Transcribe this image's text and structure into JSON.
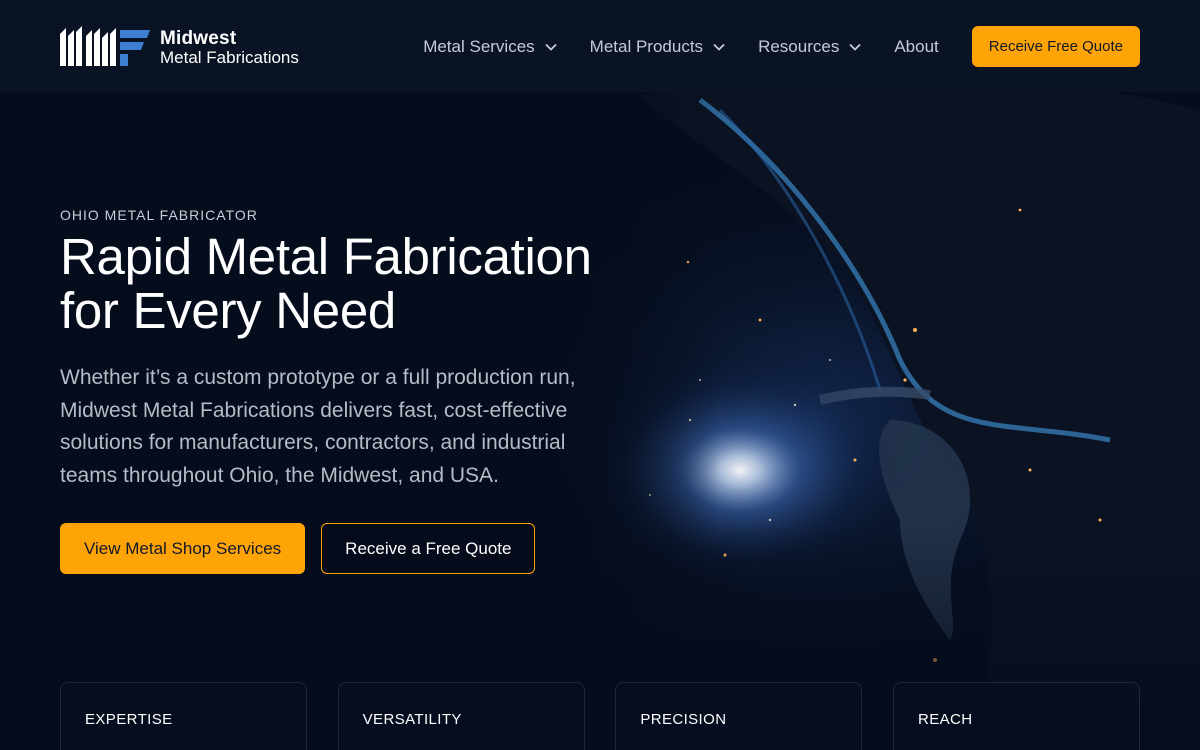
{
  "header": {
    "logo": {
      "line1": "Midwest",
      "line2": "Metal Fabrications"
    },
    "nav": [
      {
        "label": "Metal Services",
        "dropdown": true
      },
      {
        "label": "Metal Products",
        "dropdown": true
      },
      {
        "label": "Resources",
        "dropdown": true
      },
      {
        "label": "About",
        "dropdown": false
      }
    ],
    "quote_button": "Receive Free Quote"
  },
  "hero": {
    "eyebrow": "OHIO METAL FABRICATOR",
    "headline_line1": "Rapid Metal Fabrication",
    "headline_line2": "for Every Need",
    "lede": "Whether it’s a custom prototype or a full production run, Midwest Metal Fabrications delivers fast, cost-effective solutions for manufacturers, contractors, and industrial teams throughout Ohio, the Midwest, and USA.",
    "primary_cta": "View Metal Shop Services",
    "secondary_cta": "Receive a Free Quote",
    "background_image": "welder-sparks"
  },
  "cards": [
    {
      "title": "EXPERTISE"
    },
    {
      "title": "VERSATILITY"
    },
    {
      "title": "PRECISION"
    },
    {
      "title": "REACH"
    }
  ],
  "colors": {
    "background": "#050c1b",
    "header": "#0a1324",
    "accent": "#ffa406",
    "logo_blue": "#3d7fd0"
  },
  "icons": {
    "logo": "mwf-logo-icon",
    "dropdown": "chevron-down-icon"
  }
}
